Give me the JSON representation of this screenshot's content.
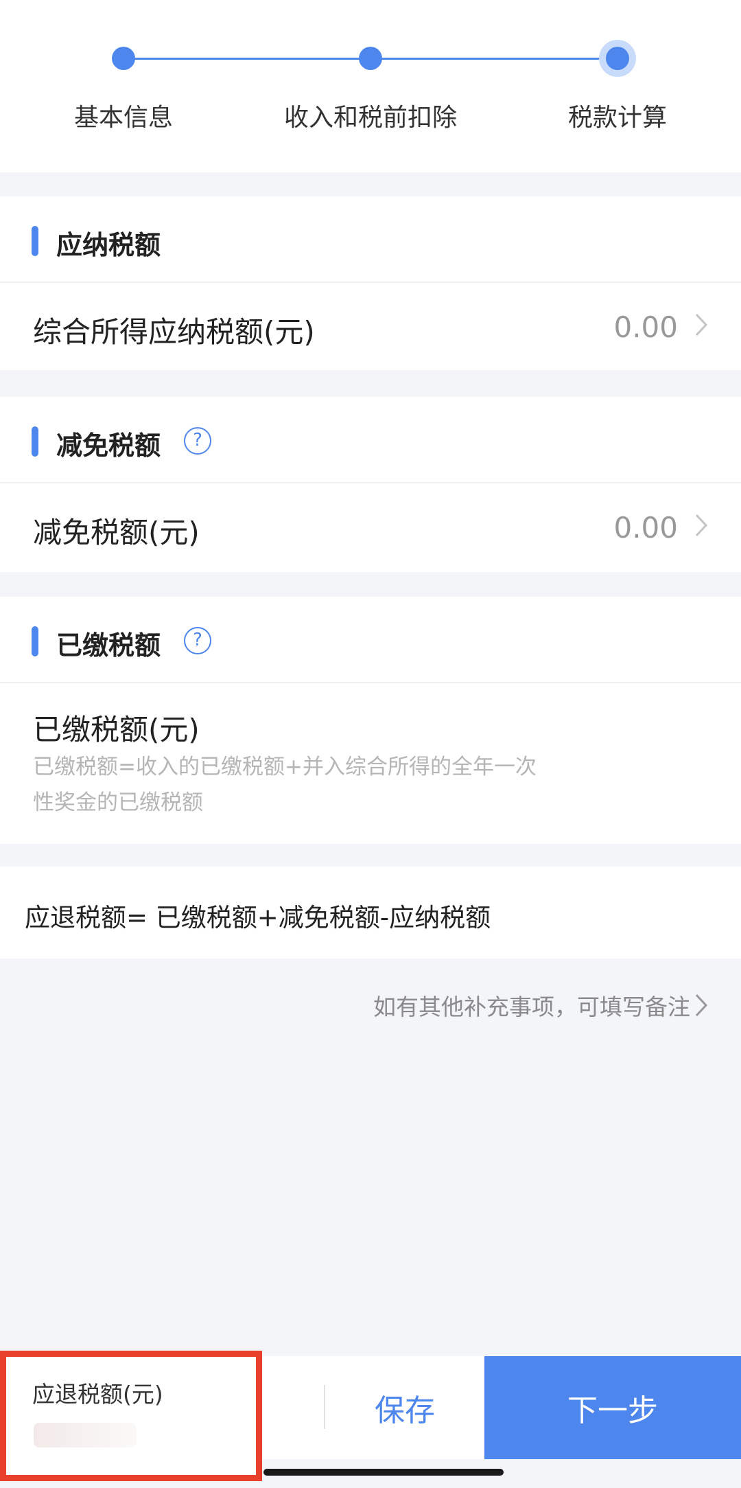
{
  "stepper": {
    "steps": [
      {
        "label": "基本信息"
      },
      {
        "label": "收入和税前扣除"
      },
      {
        "label": "税款计算"
      }
    ],
    "active_index": 2,
    "accent_color": "#4d86ec"
  },
  "sections": {
    "payable": {
      "title": "应纳税额",
      "row_label": "综合所得应纳税额(元)",
      "row_value": "0.00"
    },
    "reduction": {
      "title": "减免税额",
      "row_label": "减免税额(元)",
      "row_value": "0.00"
    },
    "paid": {
      "title": "已缴税额",
      "row_label": "已缴税额(元)",
      "note_line1": "已缴税额=收入的已缴税额+并入综合所得的全年一次",
      "note_line2": "性奖金的已缴税额"
    }
  },
  "formula": "应退税额= 已缴税额+减免税额-应纳税额",
  "remark_link": "如有其他补充事项，可填写备注",
  "bottom_bar": {
    "refund_label": "应退税额(元)",
    "save_label": "保存",
    "next_label": "下一步",
    "highlight_color": "#e8402b"
  },
  "icons": {
    "help": "question-circle-icon",
    "chevron": "chevron-right-icon"
  }
}
